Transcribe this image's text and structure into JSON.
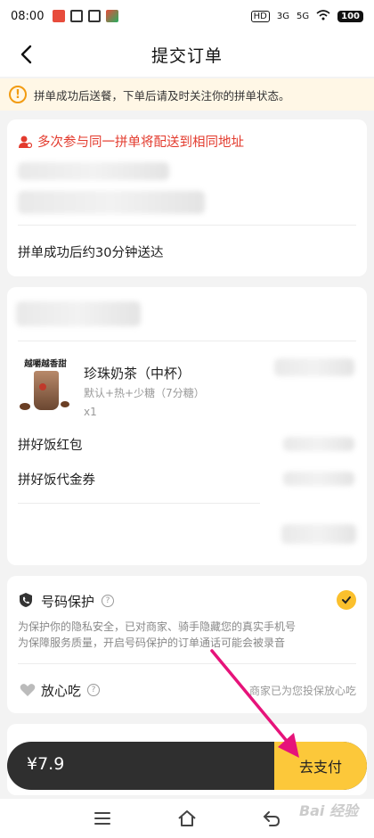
{
  "status_bar": {
    "time": "08:00",
    "network_1": "3G",
    "network_2": "5G",
    "battery": "100",
    "hd_label": "HD"
  },
  "nav": {
    "title": "提交订单"
  },
  "notice": {
    "text": "拼单成功后送餐，下单后请及时关注你的拼单状态。"
  },
  "address_card": {
    "warning": "多次参与同一拼单将配送到相同地址",
    "delivery_text": "拼单成功后约30分钟送达"
  },
  "order_card": {
    "product": {
      "brand_tag": "越嚼越香甜",
      "name": "珍珠奶茶（中杯）",
      "spec": "默认+热+少糖（7分糖）",
      "qty": "x1"
    },
    "rows": [
      {
        "label": "拼好饭红包"
      },
      {
        "label": "拼好饭代金券"
      }
    ]
  },
  "privacy_card": {
    "number_protect": {
      "title": "号码保护",
      "desc_1": "为保护你的隐私安全，已对商家、骑手隐藏您的真实手机号",
      "desc_2": "为保障服务质量，开启号码保护的订单通话可能会被录音"
    },
    "safe_eat": {
      "title": "放心吃",
      "right_text": "商家已为您投保放心吃"
    }
  },
  "pay_bar": {
    "price": "¥7.9",
    "pay_label": "去支付"
  },
  "watermark": "Bai 经验",
  "colors": {
    "accent": "#fcc83a",
    "warning_red": "#e33b2e",
    "notice_bg": "#fff7e6",
    "arrow": "#e6137a"
  }
}
